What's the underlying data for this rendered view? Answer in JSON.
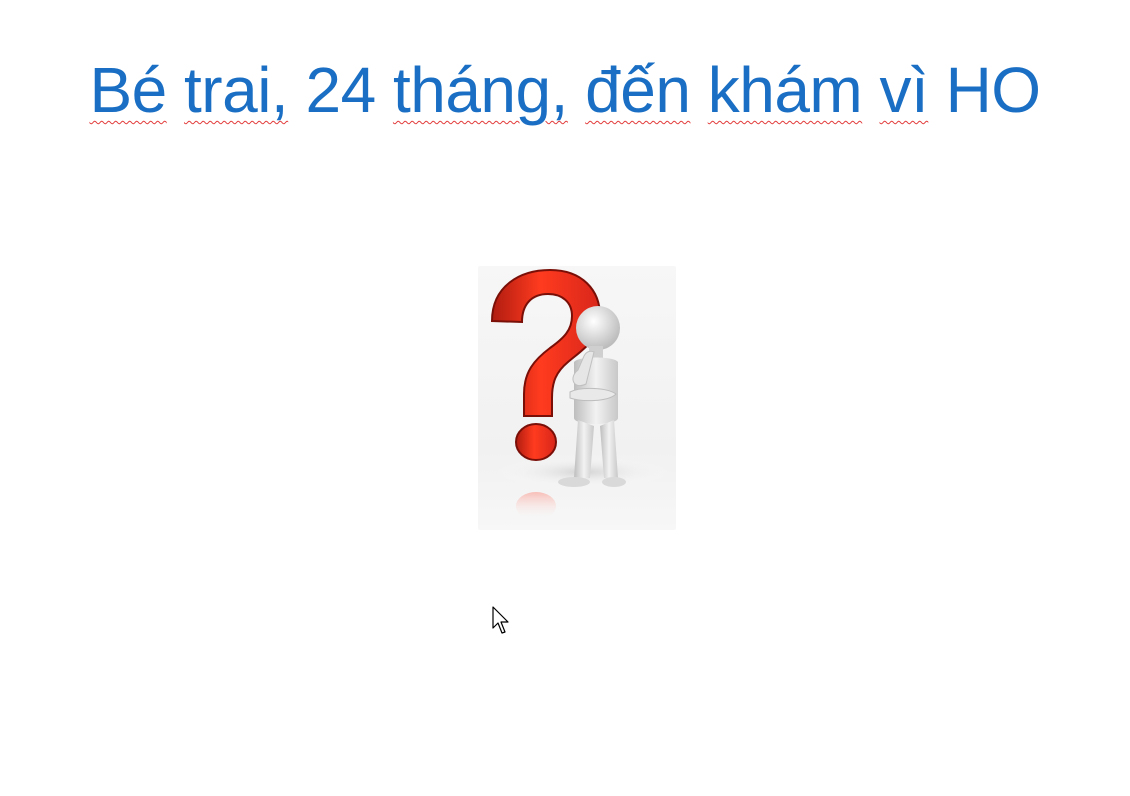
{
  "slide": {
    "title_words": [
      "Bé",
      "trai,",
      "24",
      "tháng,",
      "đến",
      "khám",
      "vì",
      "HO"
    ],
    "title_color": "#1a6fc4",
    "spellcheck_color": "#e23a3a",
    "clipart_icon": "question-mark-thinking-person-icon",
    "cursor_icon": "mouse-pointer-icon"
  }
}
